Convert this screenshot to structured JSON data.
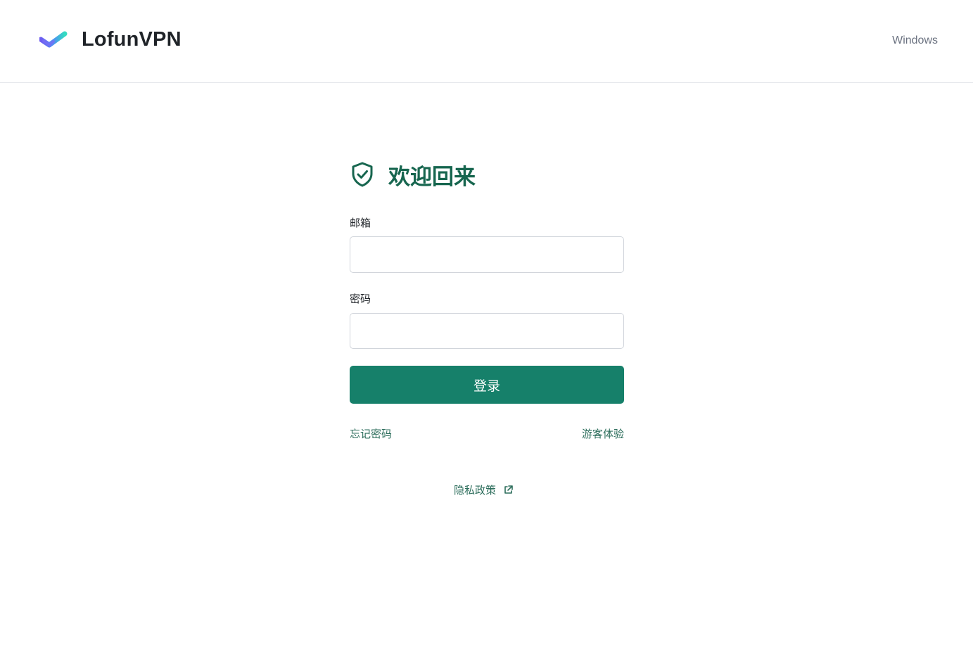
{
  "header": {
    "brand": "LofunVPN",
    "platform": "Windows",
    "logo_icon": "check-logo-icon"
  },
  "login": {
    "title": "欢迎回来",
    "title_icon": "shield-check-icon",
    "email_label": "邮箱",
    "email_value": "",
    "password_label": "密码",
    "password_value": "",
    "submit_label": "登录",
    "forgot_label": "忘记密码",
    "guest_label": "游客体验"
  },
  "footer": {
    "privacy_label": "隐私政策",
    "privacy_icon": "external-link-icon"
  },
  "colors": {
    "accent": "#16806a",
    "accent_text": "#17664f",
    "link": "#2d6e5c",
    "border": "#d1d5db"
  }
}
